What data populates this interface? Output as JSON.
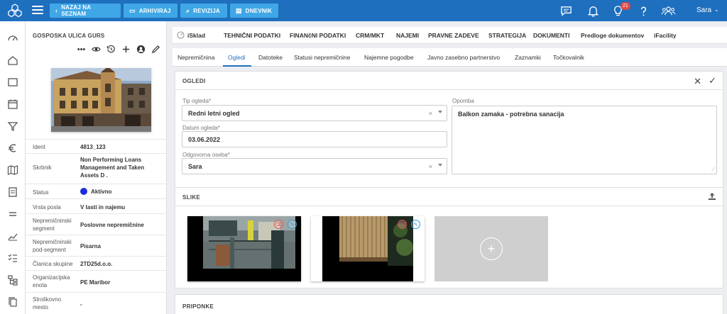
{
  "topbar": {
    "buttons": [
      {
        "label": "NAZAJ NA SEZNAM",
        "icon": "chevron-left-icon",
        "icon_glyph": "‹"
      },
      {
        "label": "ARHIVIRAJ",
        "icon": "archive-icon",
        "icon_glyph": "▭"
      },
      {
        "label": "REVIZIJA",
        "icon": "search-icon",
        "icon_glyph": "⌕"
      },
      {
        "label": "DNEVNIK",
        "icon": "log-icon",
        "icon_glyph": "▤"
      }
    ],
    "notifications_count": "21",
    "user_name": "Sara",
    "brand_color": "#1f6fbf",
    "button_color": "#3fa7e6"
  },
  "property": {
    "title": "GOSPOSKA ULICA GURS",
    "fields": [
      {
        "key": "Ident",
        "value": "4813_123"
      },
      {
        "key": "Skrbnik",
        "value": "Non Performing Loans Management and Taken Assets D ."
      },
      {
        "key": "Status",
        "value": "Aktivno"
      },
      {
        "key": "Vrsta posla",
        "value": "V lasti in najemu"
      },
      {
        "key": "Nepremičninski segment",
        "value": "Poslovne nepremičnine"
      },
      {
        "key": "Nepremičninski pod-segment",
        "value": "Pisarna"
      },
      {
        "key": "Članica skupine",
        "value": "2TD25d.o.o."
      },
      {
        "key": "Organizacijska enota",
        "value": "PE Maribor"
      },
      {
        "key": "Stroškovno mesto",
        "value": "-"
      }
    ],
    "status_color": "#1a2fd9"
  },
  "tabs_primary": [
    "iSklad",
    "TEHNIČNI PODATKI",
    "FINANčNI PODATKI",
    "CRM/MKT",
    "NAJEMI",
    "PRAVNE ZADEVE",
    "STRATEGIJA",
    "DOKUMENTI",
    "Predloge dokumentov",
    "iFacility"
  ],
  "tabs_secondary": [
    "Nepremičnina",
    "Ogledi",
    "Datoteke",
    "Statusi nepremičnine",
    "Najemne pogodbe",
    "Javno zasebno partnerstvo",
    "Zaznamki",
    "Točkovalnik"
  ],
  "tabs_secondary_active": "Ogledi",
  "ogledi": {
    "title": "OGLEDI",
    "tip_label": "Tip ogleda*",
    "tip_value": "Redni letni ogled",
    "datum_label": "Datum ogleda*",
    "datum_value": "03.06.2022",
    "oseba_label": "Odgovorna oseba*",
    "oseba_value": "Sara",
    "opomba_label": "Opomba",
    "opomba_value": "Balkon zamaka - potrebna sanacija"
  },
  "slike": {
    "title": "SLIKE"
  },
  "priponke": {
    "title": "PRIPONKE"
  }
}
